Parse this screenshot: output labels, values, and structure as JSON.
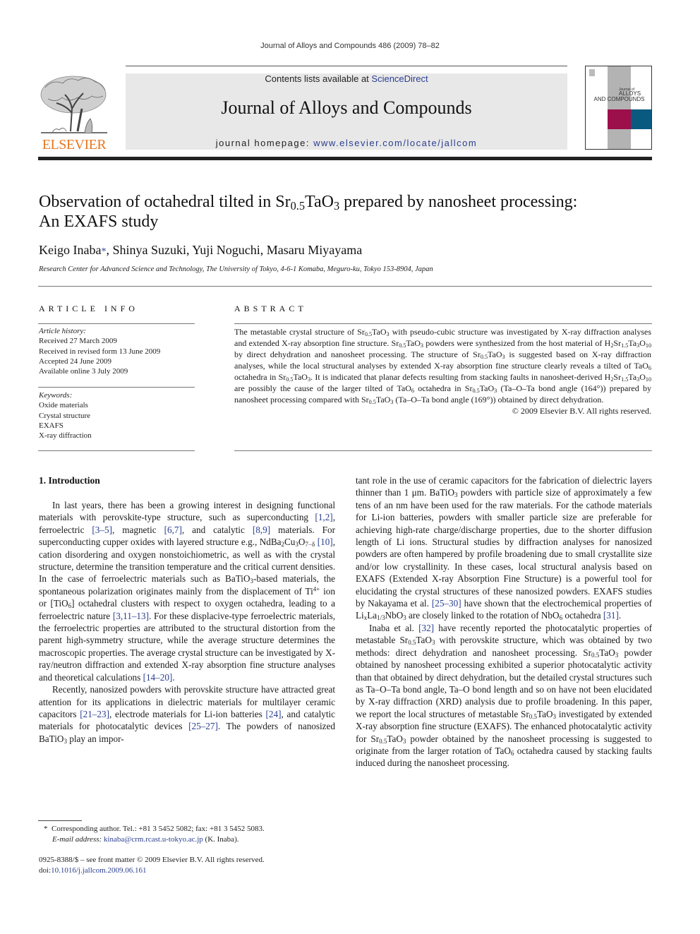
{
  "running_head": "Journal of Alloys and Compounds 486 (2009) 78–82",
  "masthead": {
    "publisher_logo_text": "ELSEVIER",
    "contents_prefix": "Contents lists available at ",
    "contents_link": "ScienceDirect",
    "journal_title": "Journal of Alloys and Compounds",
    "homepage_prefix": "journal homepage: ",
    "homepage_link": "www.elsevier.com/locate/jallcom",
    "cover": {
      "line1": "Journal of",
      "line2": "ALLOYS",
      "line3": "AND COMPOUNDS",
      "colors": {
        "strip": "#b3b3b3",
        "magenta": "#9c0f4a",
        "teal": "#0a5a80"
      }
    },
    "colors": {
      "elsevier_orange": "#e87722",
      "link_blue": "#2a3e8f",
      "box_gray": "#e8e8e8"
    }
  },
  "article": {
    "title_part1": "Observation of octahedral tilted in Sr",
    "title_sub1": "0.5",
    "title_part2": "TaO",
    "title_sub2": "3",
    "title_part3": " prepared by nanosheet processing:",
    "title_line2": "An EXAFS study",
    "authors": {
      "first": "Keigo Inaba",
      "star": "*",
      "rest": ", Shinya Suzuki, Yuji Noguchi, Masaru Miyayama"
    },
    "affiliation": "Research Center for Advanced Science and Technology, The University of Tokyo, 4-6-1 Komaba, Meguro-ku, Tokyo 153-8904, Japan"
  },
  "article_info": {
    "heading": "ARTICLE INFO",
    "history_label": "Article history:",
    "history": [
      "Received 27 March 2009",
      "Received in revised form 13 June 2009",
      "Accepted 24 June 2009",
      "Available online 3 July 2009"
    ],
    "keywords_label": "Keywords:",
    "keywords": [
      "Oxide materials",
      "Crystal structure",
      "EXAFS",
      "X-ray diffraction"
    ]
  },
  "abstract": {
    "heading": "ABSTRACT",
    "t1": "The metastable crystal structure of Sr",
    "t2": "TaO",
    "t3": " with pseudo-cubic structure was investigated by X-ray diffraction analyses and extended X-ray absorption fine structure. Sr",
    "t4": " powders were synthesized from the host material of H",
    "t5": " by direct dehydration and nanosheet processing. The structure of Sr",
    "t6": " is suggested based on X-ray diffraction analyses, while the local structural analyses by extended X-ray absorption fine structure clearly reveals a tilted of TaO",
    "t7": " octahedra in Sr",
    "t8": ". It is indicated that planar defects resulting from stacking faults in nanosheet-derived H",
    "t9": " are possibly the cause of the larger tilted of TaO",
    "t10": " octahedra in Sr",
    "t11": " (Ta–O–Ta bond angle (164°)) prepared by nanosheet processing compared with Sr",
    "t12": " (Ta–O–Ta bond angle (169°)) obtained by direct dehydration.",
    "copyright": "© 2009 Elsevier B.V. All rights reserved."
  },
  "introduction": {
    "heading": "1.  Introduction",
    "p1": {
      "a": "In last years, there has been a growing interest in designing functional materials with perovskite-type structure, such as superconducting ",
      "r1": "[1,2]",
      "b": ", ferroelectric ",
      "r2": "[3–5]",
      "c": ", magnetic ",
      "r3": "[6,7]",
      "d": ", and catalytic ",
      "r4": "[8,9]",
      "e": " materials. For superconducting cupper oxides with layered structure e.g., NdBa",
      "f": "Cu",
      "g": "O",
      "h": " ",
      "r5": "[10]",
      "i": ", cation disordering and oxygen nonstoichiometric, as well as with the crystal structure, determine the transition temperature and the critical current densities. In the case of ferroelectric materials such as BaTiO",
      "j": "-based materials, the spontaneous polarization originates mainly from the displacement of Ti",
      "k": " ion or [TiO",
      "l": "] octahedral clusters with respect to oxygen octahedra, leading to a ferroelectric nature ",
      "r6": "[3,11–13]",
      "m": ". For these displacive-type ferroelectric materials, the ferroelectric properties are attributed to the structural distortion from the parent high-symmetry structure, while the average structure determines the macroscopic properties. The average crystal structure can be investigated by X-ray/neutron diffraction and extended X-ray absorption fine structure analyses and theoretical calculations ",
      "r7": "[14–20]",
      "n": "."
    },
    "p2": {
      "a": "Recently, nanosized powders with perovskite structure have attracted great attention for its applications in dielectric materials for multilayer ceramic capacitors ",
      "r1": "[21–23]",
      "b": ", electrode materials for Li-ion batteries ",
      "r2": "[24]",
      "c": ", and catalytic materials for photocatalytic devices ",
      "r3": "[25–27]",
      "d": ". The powders of nanosized BaTiO",
      "e": " play an important role in the use of ceramic capacitors for the fabrication of dielectric layers thinner than 1 μm. BaTiO",
      "f": " powders with particle size of approximately a few tens of an nm have been used for the raw materials. For the cathode materials for Li-ion batteries, powders with smaller particle size are preferable for achieving high-rate charge/discharge properties, due to the shorter diffusion length of Li ions. Structural studies by diffraction analyses for nanosized powders are often hampered by profile broadening due to small crystallite size and/or low crystallinity. In these cases, local structural analysis based on EXAFS (Extended X-ray Absorption Fine Structure) is a powerful tool for elucidating the crystal structures of these nanosized powders. EXAFS studies by Nakayama et al. ",
      "r4": "[25–30]",
      "g": " have shown that the electrochemical properties of Li",
      "h": "La",
      "i": "NbO",
      "j": " are closely linked to the rotation of NbO",
      "k": " octahedra ",
      "r5": "[31]",
      "l": "."
    },
    "p3": {
      "a": "Inaba et al. ",
      "r1": "[32]",
      "b": " have recently reported the photocatalytic properties of metastable Sr",
      "c": "TaO",
      "d": " with perovskite structure, which was obtained by two methods: direct dehydration and nanosheet processing. Sr",
      "e": " powder obtained by nanosheet processing exhibited a superior photocatalytic activity than that obtained by direct dehydration, but the detailed crystal structures such as Ta–O–Ta bond angle, Ta–O bond length and so on have not been elucidated by X-ray diffraction (XRD) analysis due to profile broadening. In this paper, we report the local structures of metastable Sr",
      "f": " investigated by extended X-ray absorption fine structure (EXAFS). The enhanced photocatalytic activity for Sr",
      "g": " powder obtained by the nanosheet processing is suggested to originate from the larger rotation of TaO",
      "h": " octahedra caused by stacking faults induced during the nanosheet processing."
    }
  },
  "footnote": {
    "star": "*",
    "corresponding": "Corresponding author. Tel.: +81 3 5452 5082; fax: +81 3 5452 5083.",
    "email_label": "E-mail address:",
    "email": "kinaba@crm.rcast.u-tokyo.ac.jp",
    "email_suffix": " (K. Inaba)."
  },
  "front_matter": {
    "issn_line": "0925-8388/$ – see front matter © 2009 Elsevier B.V. All rights reserved.",
    "doi_label": "doi:",
    "doi": "10.1016/j.jallcom.2009.06.161"
  },
  "chem": {
    "s05": "0.5",
    "s3": "3",
    "s6": "6",
    "s2": "2",
    "s15": "1.5",
    "s10": "10",
    "s7d": "7−δ",
    "sx": "x",
    "s13": "1/3",
    "sup4": "4+",
    "Sr": "Sr",
    "TaO": "TaO",
    "TaO3": "TaO",
    "Sr_el": "Sr",
    "Ta": "Ta",
    "O": "O",
    "H": "H"
  }
}
